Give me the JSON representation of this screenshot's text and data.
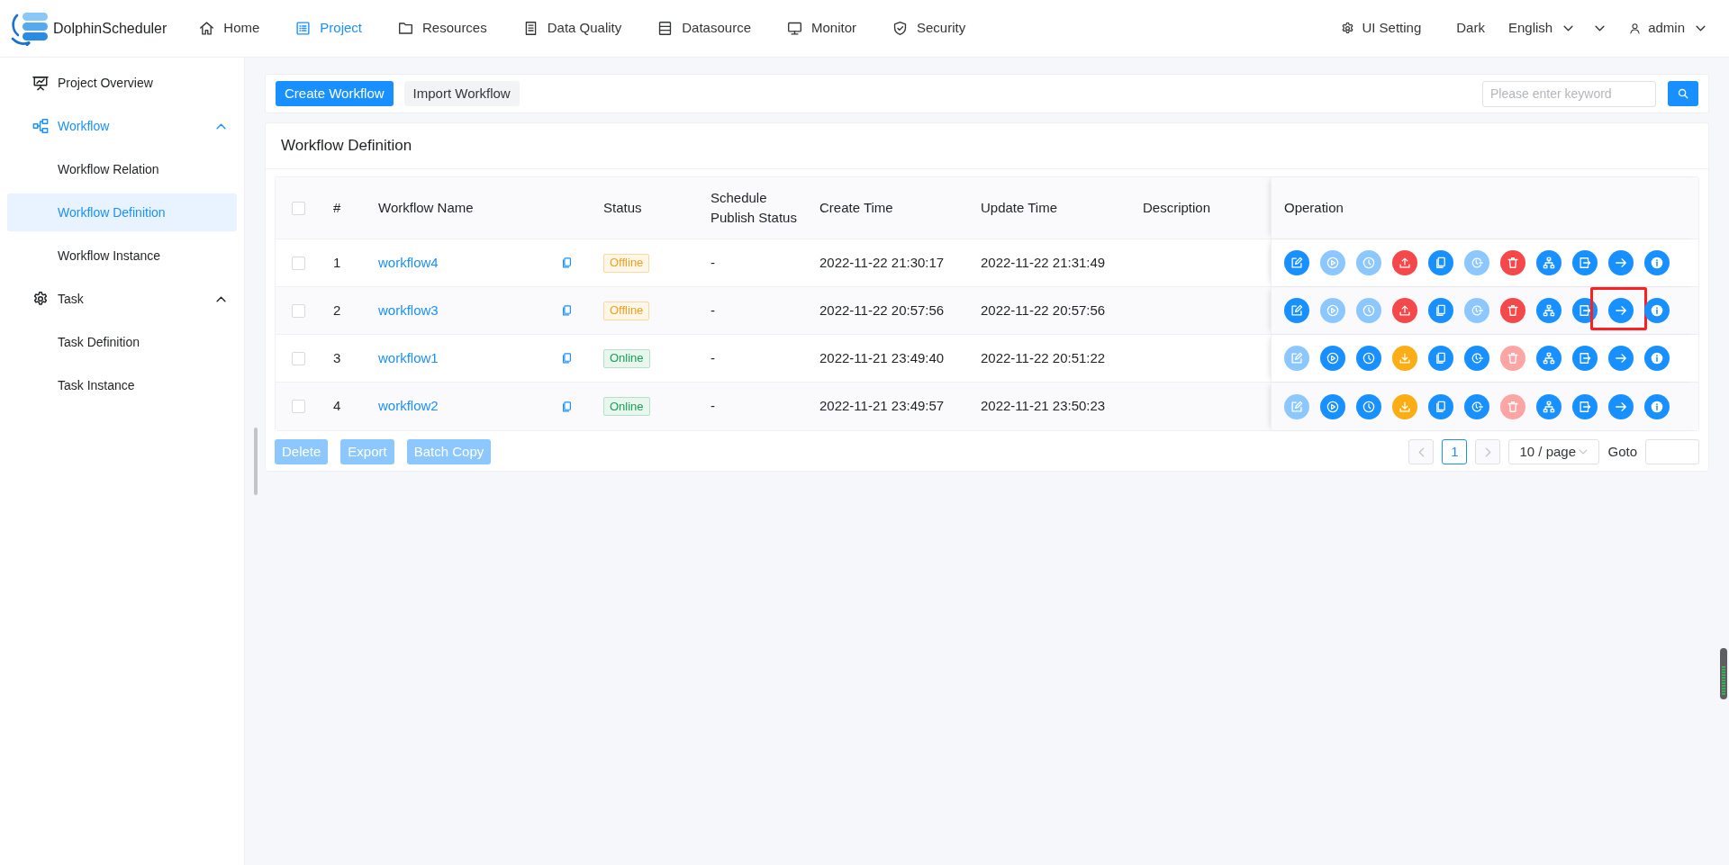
{
  "header": {
    "logo_text": "DolphinScheduler",
    "nav": [
      {
        "label": "Home",
        "selected": false
      },
      {
        "label": "Project",
        "selected": true
      },
      {
        "label": "Resources",
        "selected": false
      },
      {
        "label": "Data Quality",
        "selected": false
      },
      {
        "label": "Datasource",
        "selected": false
      },
      {
        "label": "Monitor",
        "selected": false
      },
      {
        "label": "Security",
        "selected": false
      }
    ],
    "ui_setting": "UI Setting",
    "theme": "Dark",
    "language": "English",
    "user": "admin"
  },
  "sidebar": {
    "items": [
      {
        "kind": "link",
        "label": "Project Overview",
        "selected": false
      },
      {
        "kind": "group",
        "label": "Workflow",
        "expanded": true,
        "children": [
          {
            "label": "Workflow Relation",
            "selected": false
          },
          {
            "label": "Workflow Definition",
            "selected": true
          },
          {
            "label": "Workflow Instance",
            "selected": false
          }
        ]
      },
      {
        "kind": "group",
        "label": "Task",
        "expanded": true,
        "children": [
          {
            "label": "Task Definition",
            "selected": false
          },
          {
            "label": "Task Instance",
            "selected": false
          }
        ]
      }
    ]
  },
  "toolbar": {
    "buttons": [
      {
        "label": "Create Workflow",
        "kind": "primary"
      },
      {
        "label": "Import Workflow",
        "kind": "default"
      }
    ],
    "search": {
      "placeholder": "Please enter keyword"
    }
  },
  "panel": {
    "title": "Workflow Definition"
  },
  "table": {
    "select_all": false,
    "columns": [
      "#",
      "Workflow Name",
      "Status",
      "Schedule Publish Status",
      "Create Time",
      "Update Time",
      "Description",
      "Operation"
    ],
    "rows": [
      {
        "checked": false,
        "number": "1",
        "name": "workflow4",
        "status": "Offline",
        "online": false,
        "schedule_status": "-",
        "create_time": "2022-11-22 21:30:17",
        "update_time": "2022-11-22 21:31:49",
        "operations": [
          {
            "kind": "edit",
            "disabled": false
          },
          {
            "kind": "run",
            "disabled": true
          },
          {
            "kind": "timing",
            "disabled": true
          },
          {
            "kind": "online",
            "disabled": false
          },
          {
            "kind": "copy",
            "disabled": false
          },
          {
            "kind": "cron",
            "disabled": true
          },
          {
            "kind": "delete",
            "disabled": false
          },
          {
            "kind": "tree",
            "disabled": false
          },
          {
            "kind": "export",
            "disabled": false
          },
          {
            "kind": "version",
            "disabled": false
          },
          {
            "kind": "info",
            "disabled": false
          }
        ]
      },
      {
        "checked": false,
        "number": "2",
        "name": "workflow3",
        "status": "Offline",
        "online": false,
        "schedule_status": "-",
        "create_time": "2022-11-22 20:57:56",
        "update_time": "2022-11-22 20:57:56",
        "operations": [
          {
            "kind": "edit",
            "disabled": false
          },
          {
            "kind": "run",
            "disabled": true
          },
          {
            "kind": "timing",
            "disabled": true
          },
          {
            "kind": "online",
            "disabled": false
          },
          {
            "kind": "copy",
            "disabled": false
          },
          {
            "kind": "cron",
            "disabled": true
          },
          {
            "kind": "delete",
            "disabled": false
          },
          {
            "kind": "tree",
            "disabled": false
          },
          {
            "kind": "export",
            "disabled": false
          },
          {
            "kind": "version",
            "disabled": false,
            "highlighted": true
          },
          {
            "kind": "info",
            "disabled": false
          }
        ]
      },
      {
        "checked": false,
        "number": "3",
        "name": "workflow1",
        "status": "Online",
        "online": true,
        "schedule_status": "-",
        "create_time": "2022-11-21 23:49:40",
        "update_time": "2022-11-22 20:51:22",
        "operations": [
          {
            "kind": "edit",
            "disabled": true
          },
          {
            "kind": "run",
            "disabled": false
          },
          {
            "kind": "timing",
            "disabled": false
          },
          {
            "kind": "offline",
            "disabled": false
          },
          {
            "kind": "copy",
            "disabled": false
          },
          {
            "kind": "cron",
            "disabled": false
          },
          {
            "kind": "delete",
            "disabled": true
          },
          {
            "kind": "tree",
            "disabled": false
          },
          {
            "kind": "export",
            "disabled": false
          },
          {
            "kind": "version",
            "disabled": false
          },
          {
            "kind": "info",
            "disabled": false
          }
        ]
      },
      {
        "checked": false,
        "number": "4",
        "name": "workflow2",
        "status": "Online",
        "online": true,
        "schedule_status": "-",
        "create_time": "2022-11-21 23:49:57",
        "update_time": "2022-11-21 23:50:23",
        "operations": [
          {
            "kind": "edit",
            "disabled": true
          },
          {
            "kind": "run",
            "disabled": false
          },
          {
            "kind": "timing",
            "disabled": false
          },
          {
            "kind": "offline",
            "disabled": false
          },
          {
            "kind": "copy",
            "disabled": false
          },
          {
            "kind": "cron",
            "disabled": false
          },
          {
            "kind": "delete",
            "disabled": true
          },
          {
            "kind": "tree",
            "disabled": false
          },
          {
            "kind": "export",
            "disabled": false
          },
          {
            "kind": "version",
            "disabled": false
          },
          {
            "kind": "info",
            "disabled": false
          }
        ]
      }
    ]
  },
  "batch_actions": [
    {
      "label": "Delete",
      "disabled": true
    },
    {
      "label": "Export",
      "disabled": true
    },
    {
      "label": "Batch Copy",
      "disabled": true
    }
  ],
  "pagination": {
    "prev_disabled": true,
    "pages": [
      {
        "label": "1",
        "selected": true
      }
    ],
    "next_disabled": true,
    "page_size": "10 / page",
    "goto_label": "Goto"
  }
}
